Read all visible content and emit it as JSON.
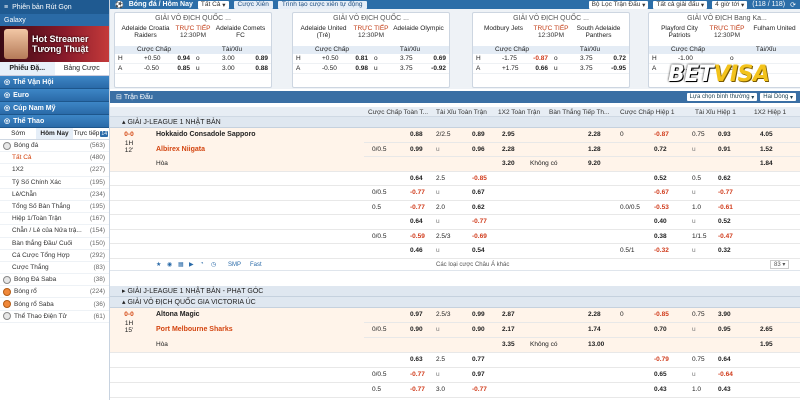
{
  "sidebar": {
    "top_label": "Phiên bản Rút Gọn",
    "galaxy": "Galaxy",
    "banner_text": "Hot Streamer\nTương Thuật",
    "tabs": [
      "Phiếu Đặ...",
      "Bảng Cược"
    ],
    "cats": [
      "Thể Vận Hội",
      "Euro",
      "Cúp Nam Mỹ",
      "Thể Thao"
    ],
    "sub_tabs": [
      "Sớm",
      "Hôm Nay",
      "Trực tiếp"
    ],
    "live_badge": "14",
    "sport_main": {
      "label": "Bóng đá",
      "count": "(563)"
    },
    "items": [
      {
        "label": "Tất Cả",
        "count": "(480)"
      },
      {
        "label": "1X2",
        "count": "(227)"
      },
      {
        "label": "Tỷ Số Chính Xác",
        "count": "(195)"
      },
      {
        "label": "Lẻ/Chẵn",
        "count": "(234)"
      },
      {
        "label": "Tổng Số Bàn Thắng",
        "count": "(195)"
      },
      {
        "label": "Hiệp 1/Toàn Trận",
        "count": "(167)"
      },
      {
        "label": "Chẵn / Lẻ của Nửa trậ...",
        "count": "(154)"
      },
      {
        "label": "Bàn thắng Đầu/ Cuối",
        "count": "(150)"
      },
      {
        "label": "Cá Cược Tổng Hợp",
        "count": "(292)"
      },
      {
        "label": "Cược Thắng",
        "count": "(83)"
      }
    ],
    "sports": [
      {
        "label": "Bóng Đá Saba",
        "count": "(38)"
      },
      {
        "label": "Bóng rổ",
        "count": "(224)"
      },
      {
        "label": "Bóng rổ Saba",
        "count": "(36)"
      },
      {
        "label": "Thể Thao Điện Tử",
        "count": "(61)"
      }
    ]
  },
  "topbar": {
    "sport": "Bóng đá / Hôm Nay",
    "filter": "Tất Cả",
    "live_btn": "Cược Xiên",
    "create_btn": "Trình tạo cược xiên tự động",
    "league_filter": "Bộ Lọc Trận Đấu",
    "all_leagues": "Tất cả giải đấu",
    "hours": "4 giờ tới",
    "counter": "(118 / 118)"
  },
  "cards": [
    {
      "league": "GIẢI VÔ ĐỊCH QUỐC ...",
      "home": "Adelaide Croatia Raiders",
      "away": "Adelaide Comets FC",
      "status": "TRỰC TIẾP",
      "time": "12:30PM",
      "h": "+0.50",
      "h_odds": "0.94",
      "u": "3.00",
      "u_odds": "0.89",
      "a": "-0.50",
      "a_odds": "0.85",
      "o": "3.00",
      "o_odds": "0.88",
      "h_neg": false,
      "a_neg": false
    },
    {
      "league": "GIẢI VÔ ĐỊCH QUỐC ...",
      "home": "Adelaide United (Trẻ)",
      "away": "Adelaide Olympic",
      "status": "TRỰC TIẾP",
      "time": "12:30PM",
      "h": "+0.50",
      "h_odds": "0.81",
      "u": "3.75",
      "u_odds": "0.69",
      "a": "-0.50",
      "a_odds": "0.98",
      "o": "3.75",
      "o_odds": "-0.92",
      "h_neg": false,
      "a_neg": false
    },
    {
      "league": "GIẢI VÔ ĐỊCH QUỐC ...",
      "home": "Modbury Jets",
      "away": "South Adelaide Panthers",
      "status": "TRỰC TIẾP",
      "time": "12:30PM",
      "h": "-1.75",
      "h_odds": "-0.87",
      "u": "3.75",
      "u_odds": "0.72",
      "a": "+1.75",
      "a_odds": "0.66",
      "o": "3.75",
      "o_odds": "-0.95",
      "h_neg": true,
      "a_neg": false
    },
    {
      "league": "GIẢI VÔ ĐỊCH Bang Ka...",
      "home": "Playford City Patriots",
      "away": "Fulham United",
      "status": "TRỰC TIẾP",
      "time": "12:30PM",
      "h": "-1.00",
      "h_odds": "",
      "u": "",
      "u_odds": "",
      "a": "+1.00",
      "a_odds": "",
      "o": "",
      "o_odds": "",
      "h_neg": false,
      "a_neg": false
    }
  ],
  "card_headers": {
    "hdp": "Cược Chấp",
    "ou": "Tài/Xỉu"
  },
  "logo": {
    "bet": "BET",
    "visa": "VISA"
  },
  "titlebar": {
    "label": "Trận Đấu",
    "sort": "Lựa chọn bình thường",
    "odds_type": "Hai Dòng"
  },
  "columns": [
    "Cược Chấp Toàn T...",
    "Tài Xỉu Toàn Trận",
    "1X2 Toàn Trận",
    "Bàn Thắng Tiếp Th...",
    "Cược Chấp Hiệp 1",
    "Tài Xỉu Hiệp 1",
    "1X2 Hiệp 1"
  ],
  "leagues": [
    {
      "left": "GIẢI J-LEAGUE 1 NHẬT BẢN",
      "right": ""
    },
    {
      "left": "GIẢI J-LEAGUE 1 NHẬT BẢN - PHẠT GÓC",
      "right": ""
    },
    {
      "left": "GIẢI VÔ ĐỊCH QUỐC GIA VICTORIA ÚC",
      "right": ""
    }
  ],
  "match1": {
    "score": "0-0",
    "half": "1H",
    "minute": "12'",
    "home": "Hokkaido Consadole Sapporo",
    "away": "Albirex Niigata",
    "draw": "Hòa",
    "rows": [
      [
        "",
        "0.88",
        "2/2.5",
        "0.89",
        "2.95",
        "",
        "2.28",
        "0",
        "-0.87",
        "0.75",
        "0.93",
        "4.05"
      ],
      [
        "0/0.5",
        "0.99",
        "u",
        "0.96",
        "2.28",
        "",
        "1.28",
        "",
        "0.72",
        "u",
        "0.91",
        "1.52"
      ],
      [
        "",
        "",
        "",
        "",
        "3.20",
        "Không có",
        "9.20",
        "",
        "",
        "",
        "",
        "1.84"
      ],
      [
        "",
        "0.64",
        "2.5",
        "-0.85",
        "",
        "",
        "",
        "",
        "0.52",
        "0.5",
        "0.62",
        ""
      ],
      [
        "0/0.5",
        "-0.77",
        "u",
        "0.67",
        "",
        "",
        "",
        "",
        "-0.67",
        "u",
        "-0.77",
        ""
      ],
      [
        "0.5",
        "-0.77",
        "2.0",
        "0.62",
        "",
        "",
        "",
        "0.0/0.5",
        "-0.53",
        "1.0",
        "-0.61",
        ""
      ],
      [
        "",
        "0.64",
        "u",
        "-0.77",
        "",
        "",
        "",
        "",
        "0.40",
        "u",
        "0.52",
        ""
      ],
      [
        "0/0.5",
        "-0.59",
        "2.5/3",
        "-0.69",
        "",
        "",
        "",
        "",
        "0.38",
        "1/1.5",
        "-0.47",
        ""
      ],
      [
        "",
        "0.46",
        "u",
        "0.54",
        "",
        "",
        "",
        "0.5/1",
        "-0.32",
        "u",
        "0.32",
        ""
      ]
    ],
    "more": "Các loại cược Châu Á khác",
    "page": "83"
  },
  "match2": {
    "score": "0-0",
    "half": "1H",
    "minute": "15'",
    "home": "Altona Magic",
    "away": "Port Melbourne Sharks",
    "draw": "Hòa",
    "rows": [
      [
        "",
        "0.97",
        "2.5/3",
        "0.99",
        "2.87",
        "",
        "2.28",
        "0",
        "-0.85",
        "0.75",
        "3.90",
        ""
      ],
      [
        "0/0.5",
        "0.90",
        "u",
        "0.90",
        "2.17",
        "",
        "1.74",
        "",
        "0.70",
        "u",
        "0.95",
        "2.65"
      ],
      [
        "",
        "",
        "",
        "",
        "3.35",
        "Không có",
        "13.00",
        "",
        "",
        "",
        "",
        "1.95"
      ],
      [
        "",
        "0.63",
        "2.5",
        "0.77",
        "",
        "",
        "",
        "",
        "-0.79",
        "0.75",
        "0.64",
        ""
      ],
      [
        "0/0.5",
        "-0.77",
        "u",
        "0.97",
        "",
        "",
        "",
        "",
        "0.65",
        "u",
        "-0.64",
        ""
      ],
      [
        "0.5",
        "-0.77",
        "3.0",
        "-0.77",
        "",
        "",
        "",
        "",
        "0.43",
        "1.0",
        "0.43",
        ""
      ]
    ]
  },
  "toolbar_icons": [
    "star-icon",
    "tv-icon",
    "stats-icon",
    "live-icon",
    "chart-icon",
    "calendar-icon"
  ],
  "toolbar_text": [
    "SMP",
    "Fast"
  ]
}
